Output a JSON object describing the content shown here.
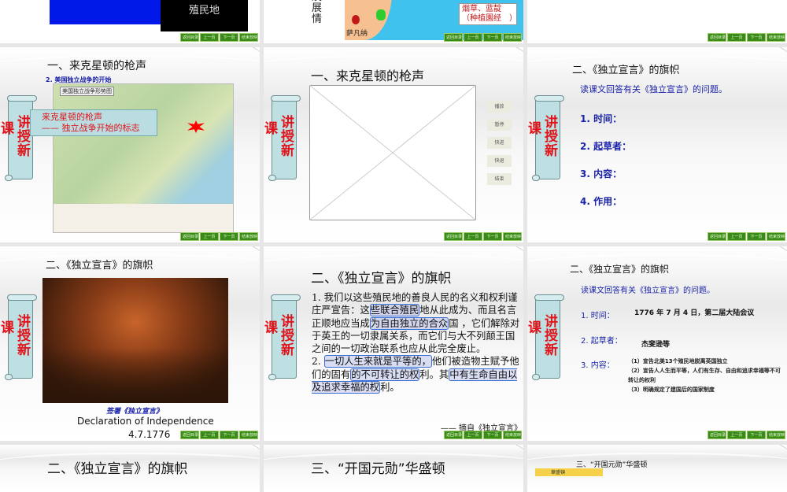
{
  "nav_buttons": [
    "返回目录",
    "上一页",
    "下一页",
    "结束放映"
  ],
  "scroll_label": {
    "ke": "课",
    "main": "讲授新"
  },
  "slides": {
    "s1": {
      "box_text": "殖民地"
    },
    "s2": {
      "side_text": "及展情",
      "map_label": "烟草、蓝靛（种植園经　）",
      "city": "萨凡纳"
    },
    "s4": {
      "title": "一、来克星顿的枪声",
      "subtitle": "2. 美国独立战争的开始",
      "map_title": "美国独立战争形势图",
      "callout_line1": "来克星顿的枪声",
      "callout_line2": "—— 独立战争开始的标志"
    },
    "s5": {
      "title": "一、来克星顿的枪声",
      "buttons": [
        "播放",
        "暂停",
        "快进",
        "快退",
        "结束"
      ]
    },
    "s6": {
      "title": "二、《独立宣言》的旗帜",
      "prompt": "读课文回答有关《独立宣言》的问题。",
      "items": [
        "1. 时间：",
        "2. 起草者：",
        "3. 内容：",
        "4. 作用："
      ]
    },
    "s7": {
      "title": "二、《独立宣言》的旗帜",
      "caption_cn": "签署《独立宣言》",
      "caption_en": "Declaration of Independence",
      "date": "4.7.1776"
    },
    "s8": {
      "title": "二、《独立宣言》的旗帜",
      "p1_a": "1. 我们以这些殖民地的善良人民的名义和权利谨庄严宣告：这",
      "p1_h1": "些联合殖民",
      "p1_b": "地从此成为、而且名言正顺地应当成",
      "p1_h2": "为自由独立的合众",
      "p1_c": "国 ，它们解除对于英王的一切隶属关系，而它们与大不列颠王国之间的一切政治联系也应从此完全废止。",
      "p2_pre": "2. ",
      "p2_h1": "一切人生来就是平等的，",
      "p2_a": "他们被造物主赋予他们的固有",
      "p2_h2": "的不可转让的权",
      "p2_b": "利。其",
      "p2_h3": "中有生命自由以及追求幸福的权",
      "p2_c": "利。",
      "source": "—— 摘自《独立宣言》"
    },
    "s9": {
      "title": "二、《独立宣言》的旗帜",
      "prompt": "读课文回答有关《独立宣言》的问题。",
      "time_label": "1. 时间：",
      "time_value": "1776 年 7 月 4 日，第二届大陆会议",
      "author_label": "2. 起草者：",
      "author_value": "杰斐逊等",
      "content_label": "3. 内容：",
      "content_items": [
        "（1）宣告北美13个殖民地脱离英国独立",
        "（2）宣告人人生而平等，人们有生存、自由和追求幸福等不可转让的权利",
        "（3）明确规定了建国后的国家制度"
      ]
    },
    "s10": {
      "title": "二、《独立宣言》的旗帜"
    },
    "s11": {
      "title": "三、“开国元勋”华盛顿"
    },
    "s12": {
      "title": "三、“开国元勋”华盛顿",
      "tag": "華盛頓"
    }
  }
}
